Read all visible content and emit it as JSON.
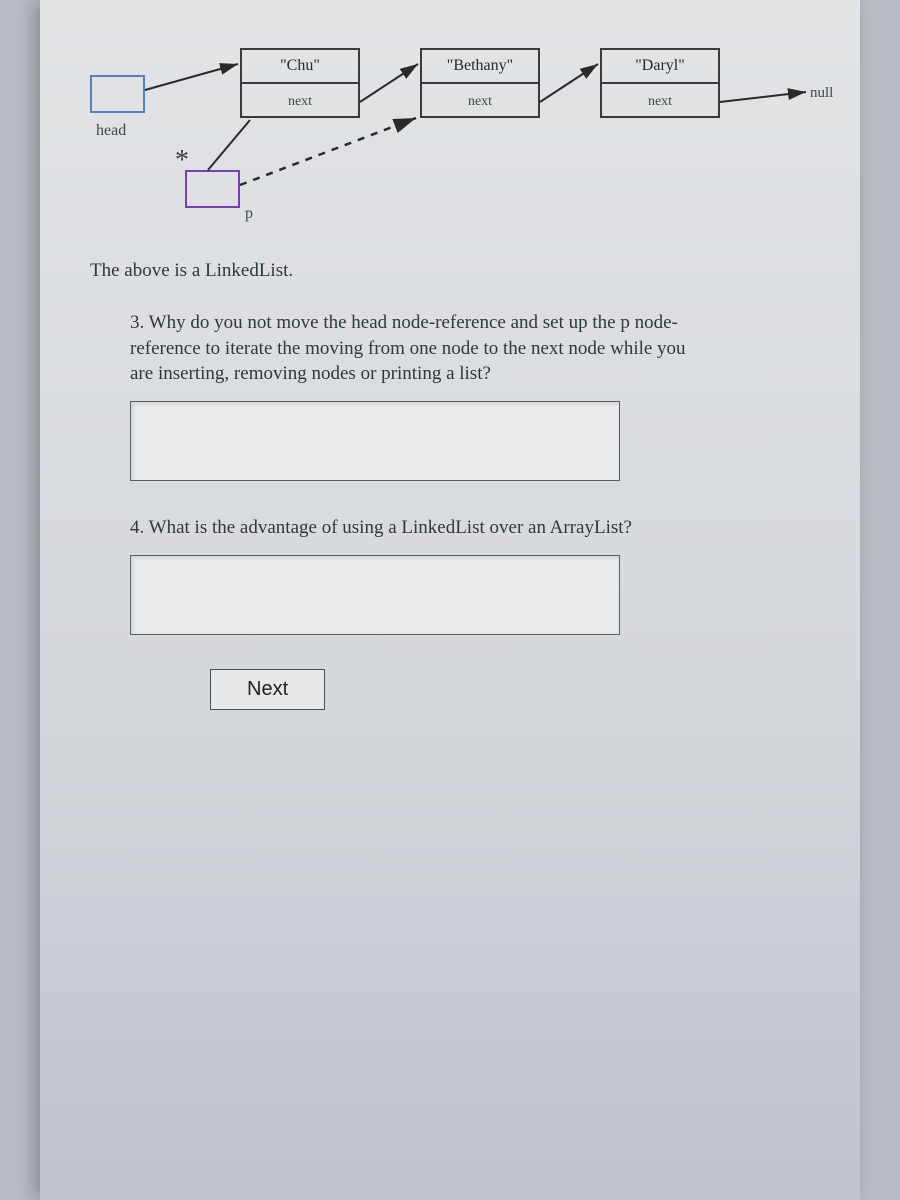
{
  "diagram": {
    "head_label": "head",
    "p_label": "p",
    "null_label": "null",
    "nodes": [
      {
        "data": "\"Chu\"",
        "next": "next"
      },
      {
        "data": "\"Bethany\"",
        "next": "next"
      },
      {
        "data": "\"Daryl\"",
        "next": "next"
      }
    ]
  },
  "intro": "The above is a LinkedList.",
  "q3": "3. Why do you not move the head node-reference and set up the p node-reference to iterate the moving from one node to the next node while you are inserting, removing nodes or printing a list?",
  "q4": "4. What is the advantage of using a LinkedList over an ArrayList?",
  "answers": {
    "a3": "",
    "a4": ""
  },
  "next_button": "Next"
}
